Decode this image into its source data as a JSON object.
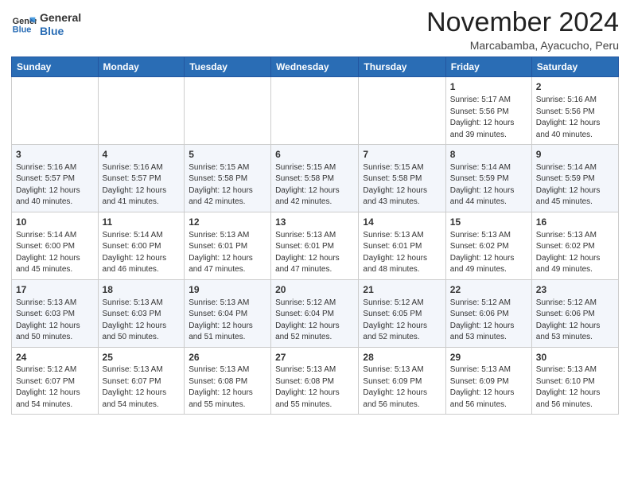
{
  "header": {
    "logo_line1": "General",
    "logo_line2": "Blue",
    "title": "November 2024",
    "location": "Marcabamba, Ayacucho, Peru"
  },
  "weekdays": [
    "Sunday",
    "Monday",
    "Tuesday",
    "Wednesday",
    "Thursday",
    "Friday",
    "Saturday"
  ],
  "weeks": [
    [
      {
        "day": "",
        "detail": ""
      },
      {
        "day": "",
        "detail": ""
      },
      {
        "day": "",
        "detail": ""
      },
      {
        "day": "",
        "detail": ""
      },
      {
        "day": "",
        "detail": ""
      },
      {
        "day": "1",
        "detail": "Sunrise: 5:17 AM\nSunset: 5:56 PM\nDaylight: 12 hours\nand 39 minutes."
      },
      {
        "day": "2",
        "detail": "Sunrise: 5:16 AM\nSunset: 5:56 PM\nDaylight: 12 hours\nand 40 minutes."
      }
    ],
    [
      {
        "day": "3",
        "detail": "Sunrise: 5:16 AM\nSunset: 5:57 PM\nDaylight: 12 hours\nand 40 minutes."
      },
      {
        "day": "4",
        "detail": "Sunrise: 5:16 AM\nSunset: 5:57 PM\nDaylight: 12 hours\nand 41 minutes."
      },
      {
        "day": "5",
        "detail": "Sunrise: 5:15 AM\nSunset: 5:58 PM\nDaylight: 12 hours\nand 42 minutes."
      },
      {
        "day": "6",
        "detail": "Sunrise: 5:15 AM\nSunset: 5:58 PM\nDaylight: 12 hours\nand 42 minutes."
      },
      {
        "day": "7",
        "detail": "Sunrise: 5:15 AM\nSunset: 5:58 PM\nDaylight: 12 hours\nand 43 minutes."
      },
      {
        "day": "8",
        "detail": "Sunrise: 5:14 AM\nSunset: 5:59 PM\nDaylight: 12 hours\nand 44 minutes."
      },
      {
        "day": "9",
        "detail": "Sunrise: 5:14 AM\nSunset: 5:59 PM\nDaylight: 12 hours\nand 45 minutes."
      }
    ],
    [
      {
        "day": "10",
        "detail": "Sunrise: 5:14 AM\nSunset: 6:00 PM\nDaylight: 12 hours\nand 45 minutes."
      },
      {
        "day": "11",
        "detail": "Sunrise: 5:14 AM\nSunset: 6:00 PM\nDaylight: 12 hours\nand 46 minutes."
      },
      {
        "day": "12",
        "detail": "Sunrise: 5:13 AM\nSunset: 6:01 PM\nDaylight: 12 hours\nand 47 minutes."
      },
      {
        "day": "13",
        "detail": "Sunrise: 5:13 AM\nSunset: 6:01 PM\nDaylight: 12 hours\nand 47 minutes."
      },
      {
        "day": "14",
        "detail": "Sunrise: 5:13 AM\nSunset: 6:01 PM\nDaylight: 12 hours\nand 48 minutes."
      },
      {
        "day": "15",
        "detail": "Sunrise: 5:13 AM\nSunset: 6:02 PM\nDaylight: 12 hours\nand 49 minutes."
      },
      {
        "day": "16",
        "detail": "Sunrise: 5:13 AM\nSunset: 6:02 PM\nDaylight: 12 hours\nand 49 minutes."
      }
    ],
    [
      {
        "day": "17",
        "detail": "Sunrise: 5:13 AM\nSunset: 6:03 PM\nDaylight: 12 hours\nand 50 minutes."
      },
      {
        "day": "18",
        "detail": "Sunrise: 5:13 AM\nSunset: 6:03 PM\nDaylight: 12 hours\nand 50 minutes."
      },
      {
        "day": "19",
        "detail": "Sunrise: 5:13 AM\nSunset: 6:04 PM\nDaylight: 12 hours\nand 51 minutes."
      },
      {
        "day": "20",
        "detail": "Sunrise: 5:12 AM\nSunset: 6:04 PM\nDaylight: 12 hours\nand 52 minutes."
      },
      {
        "day": "21",
        "detail": "Sunrise: 5:12 AM\nSunset: 6:05 PM\nDaylight: 12 hours\nand 52 minutes."
      },
      {
        "day": "22",
        "detail": "Sunrise: 5:12 AM\nSunset: 6:06 PM\nDaylight: 12 hours\nand 53 minutes."
      },
      {
        "day": "23",
        "detail": "Sunrise: 5:12 AM\nSunset: 6:06 PM\nDaylight: 12 hours\nand 53 minutes."
      }
    ],
    [
      {
        "day": "24",
        "detail": "Sunrise: 5:12 AM\nSunset: 6:07 PM\nDaylight: 12 hours\nand 54 minutes."
      },
      {
        "day": "25",
        "detail": "Sunrise: 5:13 AM\nSunset: 6:07 PM\nDaylight: 12 hours\nand 54 minutes."
      },
      {
        "day": "26",
        "detail": "Sunrise: 5:13 AM\nSunset: 6:08 PM\nDaylight: 12 hours\nand 55 minutes."
      },
      {
        "day": "27",
        "detail": "Sunrise: 5:13 AM\nSunset: 6:08 PM\nDaylight: 12 hours\nand 55 minutes."
      },
      {
        "day": "28",
        "detail": "Sunrise: 5:13 AM\nSunset: 6:09 PM\nDaylight: 12 hours\nand 56 minutes."
      },
      {
        "day": "29",
        "detail": "Sunrise: 5:13 AM\nSunset: 6:09 PM\nDaylight: 12 hours\nand 56 minutes."
      },
      {
        "day": "30",
        "detail": "Sunrise: 5:13 AM\nSunset: 6:10 PM\nDaylight: 12 hours\nand 56 minutes."
      }
    ]
  ]
}
